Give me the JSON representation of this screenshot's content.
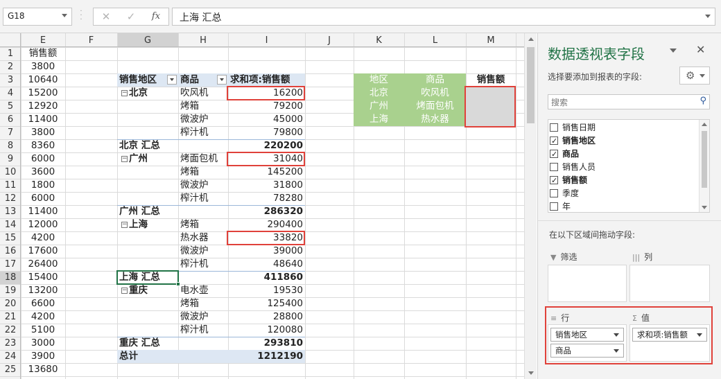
{
  "formula_bar": {
    "name_box": "G18",
    "cancel_icon": "✕",
    "enter_icon": "✓",
    "fx_label": "fx",
    "formula": "上海 汇总"
  },
  "columns": [
    "E",
    "F",
    "G",
    "H",
    "I",
    "J",
    "K",
    "L",
    "M"
  ],
  "rows": [
    "1",
    "2",
    "3",
    "4",
    "5",
    "6",
    "7",
    "8",
    "9",
    "10",
    "11",
    "12",
    "13",
    "14",
    "15",
    "16",
    "17",
    "18",
    "19",
    "20",
    "21",
    "22",
    "23",
    "24",
    "25"
  ],
  "column_e": [
    "销售额",
    "3800",
    "10640",
    "15200",
    "12920",
    "11400",
    "3800",
    "8360",
    "6000",
    "3600",
    "1800",
    "6000",
    "11400",
    "12000",
    "4200",
    "17600",
    "26400",
    "15400",
    "13200",
    "6600",
    "4200",
    "5100",
    "3000",
    "3900",
    "13680"
  ],
  "pivot": {
    "header_region": "销售地区",
    "header_product": "商品",
    "header_sum": "求和项:销售额",
    "rows": [
      {
        "region": "北京",
        "product": "吹风机",
        "value": "16200",
        "row": 4
      },
      {
        "product": "烤箱",
        "value": "79200",
        "row": 5
      },
      {
        "product": "微波炉",
        "value": "45000",
        "row": 6
      },
      {
        "product": "榨汁机",
        "value": "79800",
        "row": 7
      },
      {
        "subtotal": "北京 汇总",
        "value": "220200",
        "row": 8
      },
      {
        "region": "广州",
        "product": "烤面包机",
        "value": "31040",
        "row": 9
      },
      {
        "product": "烤箱",
        "value": "145200",
        "row": 10
      },
      {
        "product": "微波炉",
        "value": "31800",
        "row": 11
      },
      {
        "product": "榨汁机",
        "value": "78280",
        "row": 12
      },
      {
        "subtotal": "广州 汇总",
        "value": "286320",
        "row": 13
      },
      {
        "region": "上海",
        "product": "烤箱",
        "value": "290400",
        "row": 14
      },
      {
        "product": "热水器",
        "value": "33820",
        "row": 15
      },
      {
        "product": "微波炉",
        "value": "39000",
        "row": 16
      },
      {
        "product": "榨汁机",
        "value": "48640",
        "row": 17
      },
      {
        "subtotal": "上海 汇总",
        "value": "411860",
        "row": 18
      },
      {
        "region": "重庆",
        "product": "电水壶",
        "value": "19530",
        "row": 19
      },
      {
        "product": "烤箱",
        "value": "125400",
        "row": 20
      },
      {
        "product": "微波炉",
        "value": "28800",
        "row": 21
      },
      {
        "product": "榨汁机",
        "value": "120080",
        "row": 22
      },
      {
        "subtotal": "重庆 汇总",
        "value": "293810",
        "row": 23
      },
      {
        "grand_total": "总计",
        "value": "1212190",
        "row": 24
      }
    ]
  },
  "lookup_table": {
    "header_region": "地区",
    "header_product": "商品",
    "header_sales": "销售额",
    "rows": [
      {
        "region": "北京",
        "product": "吹风机"
      },
      {
        "region": "广州",
        "product": "烤面包机"
      },
      {
        "region": "上海",
        "product": "热水器"
      }
    ]
  },
  "pane": {
    "title": "数据透视表字段",
    "close_icon": "✕",
    "subtitle": "选择要添加到报表的字段:",
    "gear_icon": "⚙",
    "search_placeholder": "搜索",
    "search_icon": "⚲",
    "fields": [
      {
        "label": "销售日期",
        "checked": false
      },
      {
        "label": "销售地区",
        "checked": true
      },
      {
        "label": "商品",
        "checked": true
      },
      {
        "label": "销售人员",
        "checked": false
      },
      {
        "label": "销售额",
        "checked": true
      },
      {
        "label": "季度",
        "checked": false
      },
      {
        "label": "年",
        "checked": false
      }
    ],
    "drag_hint": "在以下区域间拖动字段:",
    "filter_label": "筛选",
    "column_label": "列",
    "row_label": "行",
    "value_label": "值",
    "row_fields": [
      "销售地区",
      "商品"
    ],
    "value_fields": [
      "求和项:销售额"
    ],
    "filter_icon": "▼",
    "column_icon": "|||",
    "row_icon": "≡",
    "value_icon": "Σ"
  },
  "colors": {
    "accent": "#217346",
    "highlight_red": "#e0413a",
    "pivot_header_blue": "#dde7f3",
    "lookup_green": "#a9d18e",
    "lookup_gray": "#d9d9d9"
  }
}
